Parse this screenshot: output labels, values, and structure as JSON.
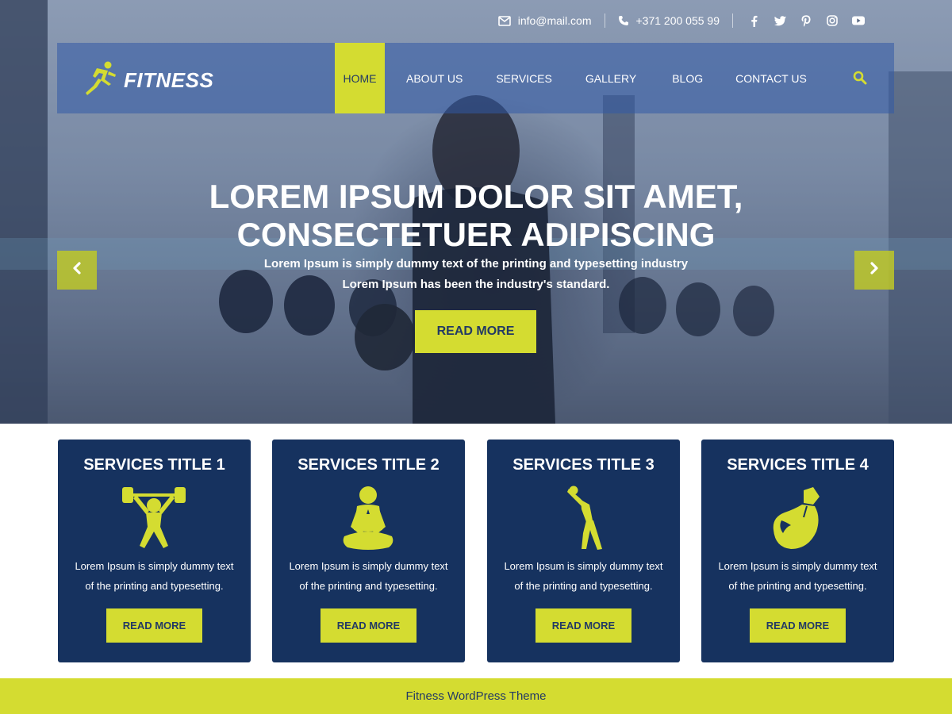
{
  "topbar": {
    "email": "info@mail.com",
    "phone": "+371 200 055 99",
    "social_icons": [
      "facebook-icon",
      "twitter-icon",
      "pinterest-icon",
      "instagram-icon",
      "youtube-icon"
    ]
  },
  "logo": {
    "text": "FITNESS",
    "icon": "runner-icon"
  },
  "nav": {
    "items": [
      {
        "label": "HOME",
        "active": true
      },
      {
        "label": "ABOUT US"
      },
      {
        "label": "SERVICES"
      },
      {
        "label": "GALLERY"
      },
      {
        "label": "BLOG"
      },
      {
        "label": "CONTACT US"
      }
    ],
    "search_icon": "search-icon"
  },
  "hero": {
    "title_line1": "LOREM IPSUM DOLOR SIT AMET,",
    "title_line2": "CONSECTETUER ADIPISCING",
    "subtitle_line1": "Lorem Ipsum is simply dummy text of the printing and typesetting industry",
    "subtitle_line2": "Lorem Ipsum has been the industry's standard.",
    "button": "READ MORE",
    "prev_icon": "chevron-left-icon",
    "next_icon": "chevron-right-icon"
  },
  "services": [
    {
      "title": "SERVICES TITLE 1",
      "icon": "weightlifter-icon",
      "text_line1": "Lorem Ipsum is simply dummy text",
      "text_line2": "of the printing and typesetting.",
      "button": "READ MORE"
    },
    {
      "title": "SERVICES TITLE 2",
      "icon": "meditation-icon",
      "text_line1": "Lorem Ipsum is simply dummy text",
      "text_line2": "of the printing and typesetting.",
      "button": "READ MORE"
    },
    {
      "title": "SERVICES TITLE 3",
      "icon": "stretching-icon",
      "text_line1": "Lorem Ipsum is simply dummy text",
      "text_line2": "of the printing and typesetting.",
      "button": "READ MORE"
    },
    {
      "title": "SERVICES TITLE 4",
      "icon": "boxing-glove-icon",
      "text_line1": "Lorem Ipsum is simply dummy text",
      "text_line2": "of the printing and typesetting.",
      "button": "READ MORE"
    }
  ],
  "footer": {
    "text": "Fitness WordPress Theme"
  },
  "colors": {
    "accent": "#d4dc31",
    "navy": "#16325f",
    "dark_text": "#233a64"
  }
}
